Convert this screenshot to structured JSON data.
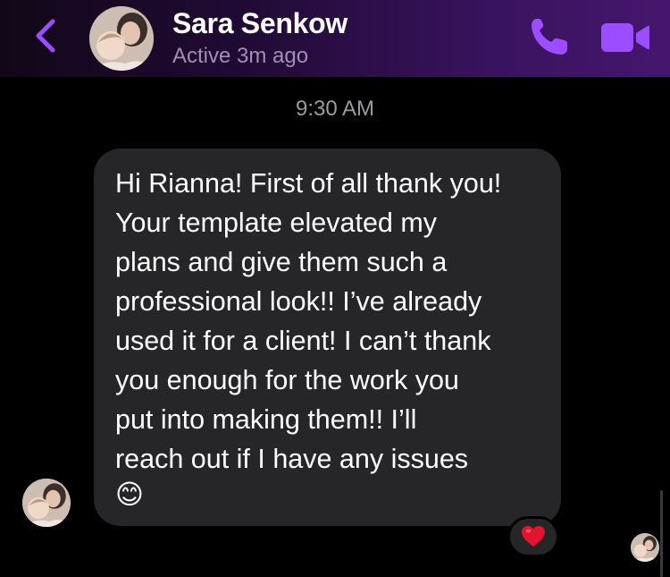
{
  "header": {
    "contact_name": "Sara Senkow",
    "status": "Active 3m ago",
    "icons": {
      "back": "chevron-left-icon",
      "call": "phone-icon",
      "video": "video-camera-icon"
    },
    "accent_color": "#9b4dff"
  },
  "conversation": {
    "timestamp": "9:30 AM",
    "messages": [
      {
        "sender": "Sara Senkow",
        "text": "Hi Rianna! First of all thank you!\nYour template elevated my\nplans and give them such a\nprofessional look!! I’ve already\nused it for a client! I can’t thank\nyou enough for the work you\nput into making them!! I’ll\nreach out if I have any issues",
        "emoji": "😊",
        "reaction": "❤️"
      }
    ]
  },
  "colors": {
    "background": "#000000",
    "bubble": "#262628",
    "timestamp": "#9b9b9f",
    "status": "#a48fb3"
  }
}
